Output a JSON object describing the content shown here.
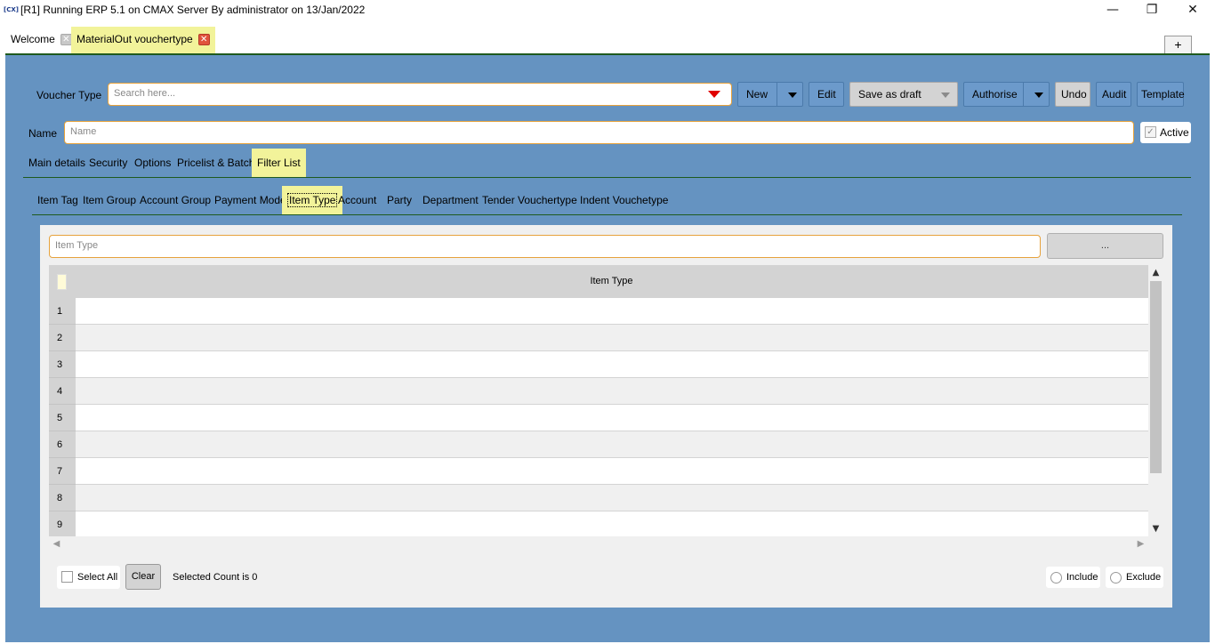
{
  "window": {
    "icon_text": "[CX]",
    "title": "[R1] Running ERP 5.1 on CMAX Server By administrator on 13/Jan/2022",
    "minimize": "—",
    "maximize": "❐",
    "close": "✕"
  },
  "doc_tabs": [
    {
      "label": "Welcome",
      "close": "✕"
    },
    {
      "label": "MaterialOut vouchertype",
      "close": "✕"
    }
  ],
  "plus_label": "+",
  "voucher_type": {
    "label": "Voucher Type",
    "placeholder": "Search here..."
  },
  "toolbar": {
    "new_label": "New",
    "edit_label": "Edit",
    "save_draft_label": "Save as draft",
    "authorise_label": "Authorise",
    "undo_label": "Undo",
    "audit_label": "Audit",
    "template_label": "Template"
  },
  "name_field": {
    "label": "Name",
    "placeholder": "Name"
  },
  "active": {
    "label": "Active",
    "check": "✓"
  },
  "main_tabs": [
    "Main details",
    "Security",
    "Options",
    "Pricelist & Batch",
    "Filter List"
  ],
  "filter_tabs": [
    "Item Tag",
    "Item Group",
    "Account Group",
    "Payment Mode",
    "Item Type",
    "Account",
    "Party",
    "Department",
    "Tender Vouchertype",
    "Indent Vouchetype"
  ],
  "item_type_field": {
    "placeholder": "Item Type"
  },
  "ellipsis_label": "...",
  "grid": {
    "column": "Item Type",
    "rows": [
      "1",
      "2",
      "3",
      "4",
      "5",
      "6",
      "7",
      "8",
      "9"
    ]
  },
  "scroll": {
    "up": "▲",
    "down": "▼",
    "left": "◀",
    "right": "▶"
  },
  "footer": {
    "select_all": "Select All",
    "clear": "Clear",
    "selected_count": "Selected Count is 0",
    "include": "Include",
    "exclude": "Exclude"
  },
  "colors": {
    "panel_blue": "#6593c1",
    "tab_highlight": "#f2f39a",
    "field_border": "#e6a23c",
    "dropdown_arrow": "#e00000"
  }
}
